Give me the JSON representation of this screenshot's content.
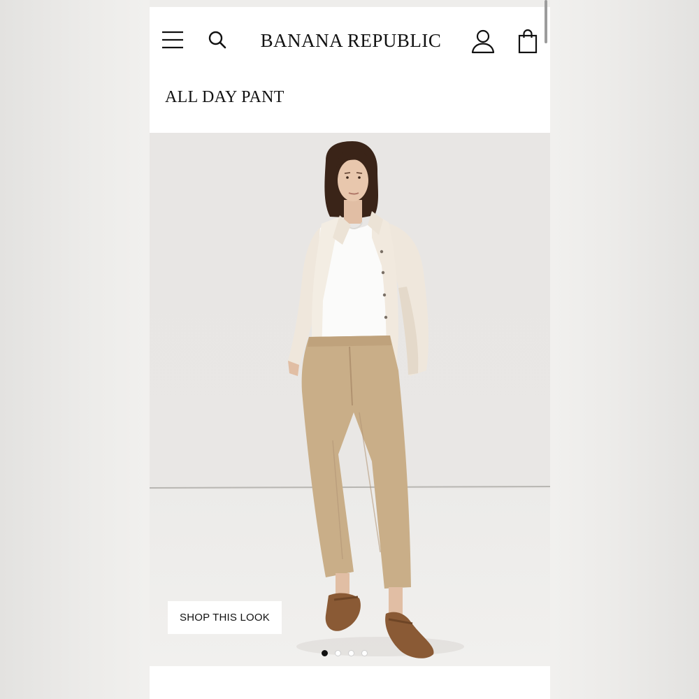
{
  "header": {
    "brand": "BANANA REPUBLIC",
    "icons": {
      "menu": "hamburger-menu-icon",
      "search": "search-icon",
      "account": "person-icon",
      "bag": "shopping-bag-icon"
    }
  },
  "page": {
    "title": "ALL DAY PANT"
  },
  "hero": {
    "cta_label": "SHOP THIS LOOK",
    "carousel": {
      "slide_count": 4,
      "active_index": 0
    }
  },
  "colors": {
    "text": "#111111",
    "page_background": "#ffffff",
    "backdrop": "#e9e7e5",
    "pants": "#c8ad88",
    "shoes": "#8a5a35"
  }
}
